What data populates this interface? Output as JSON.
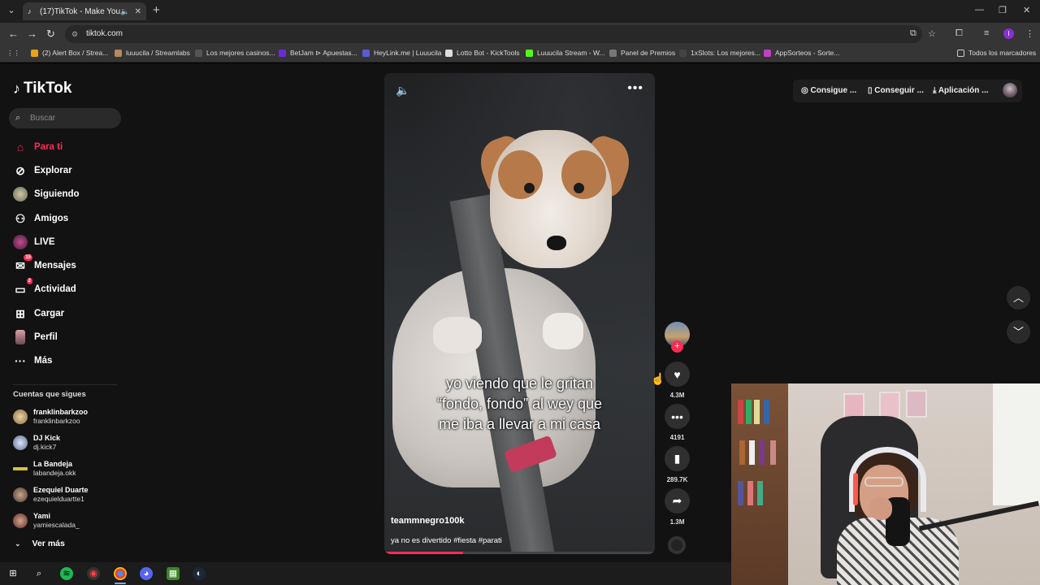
{
  "browser": {
    "tab_title": "(17)TikTok - Make Your Day",
    "url": "tiktok.com",
    "bookmarks": [
      "(2) Alert Box / Strea...",
      "luuucila / Streamlabs",
      "Los mejores casinos...",
      "BetJam ⊳ Apuestas...",
      "HeyLink.me | Luuucila",
      "Lotto Bot - KickTools",
      "Luuucila Stream - W...",
      "Panel de Premios",
      "1xSlots: Los mejores...",
      "AppSorteos - Sorte..."
    ],
    "all_bookmarks": "Todos los marcadores"
  },
  "sidebar": {
    "logo": "TikTok",
    "search_placeholder": "Buscar",
    "nav": [
      {
        "label": "Para ti",
        "icon": "home-icon"
      },
      {
        "label": "Explorar",
        "icon": "compass-icon"
      },
      {
        "label": "Siguiendo",
        "icon": "following-avatar-icon"
      },
      {
        "label": "Amigos",
        "icon": "friends-icon"
      },
      {
        "label": "LIVE",
        "icon": "live-icon"
      },
      {
        "label": "Mensajes",
        "icon": "messages-icon",
        "badge": "15"
      },
      {
        "label": "Actividad",
        "icon": "activity-icon",
        "badge": "2"
      },
      {
        "label": "Cargar",
        "icon": "upload-icon"
      },
      {
        "label": "Perfil",
        "icon": "profile-icon"
      },
      {
        "label": "Más",
        "icon": "more-icon"
      }
    ],
    "following_heading": "Cuentas que sigues",
    "following": [
      {
        "name": "franklinbarkzoo",
        "handle": "franklinbarkzoo"
      },
      {
        "name": "DJ Kick",
        "handle": "dj.kick7"
      },
      {
        "name": "La Bandeja",
        "handle": "labandeja.okk"
      },
      {
        "name": "Ezequiel Duarte",
        "handle": "ezequielduartte1"
      },
      {
        "name": "Yami",
        "handle": "yamiescalada_"
      }
    ],
    "see_more": "Ver más"
  },
  "video": {
    "caption_lines": [
      "yo viendo que le gritan",
      "“fondo, fondo” al wey que",
      "me iba a llevar a mi casa"
    ],
    "author": "teammnegro100k",
    "description": "ya no es divertido #fiesta #parati",
    "progress": 0.29,
    "likes": "4.3M",
    "comments": "4191",
    "saves": "289.7K",
    "shares": "1.3M"
  },
  "header": {
    "coins": "Consigue ...",
    "get_app": "Conseguir ...",
    "app": "Aplicación ..."
  },
  "colors": {
    "brand": "#fe2c55",
    "background": "#121212"
  }
}
